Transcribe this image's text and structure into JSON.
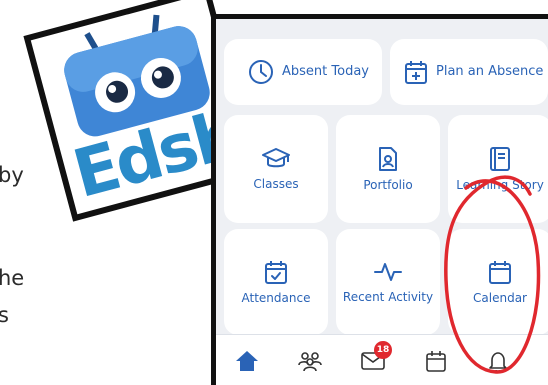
{
  "background": {
    "fragments": [
      "by",
      "he",
      "s"
    ]
  },
  "logo": {
    "wordmark": "Edsby",
    "brand_color": "#2a8bc9"
  },
  "tiles": {
    "absent_today": "Absent Today",
    "plan_absence": "Plan an Absence",
    "classes": "Classes",
    "portfolio": "Portfolio",
    "learning_story": "Learning Story",
    "attendance": "Attendance",
    "recent_activity": "Recent Activity",
    "calendar": "Calendar"
  },
  "nav": {
    "items": [
      {
        "icon": "home-icon",
        "active": true
      },
      {
        "icon": "people-icon"
      },
      {
        "icon": "mail-icon",
        "badge": "18"
      },
      {
        "icon": "calendar-icon"
      },
      {
        "icon": "bell-icon"
      }
    ],
    "mail_badge": "18"
  },
  "colors": {
    "accent": "#2a63b6",
    "annotation": "#e0282e",
    "badge": "#e0282e"
  }
}
